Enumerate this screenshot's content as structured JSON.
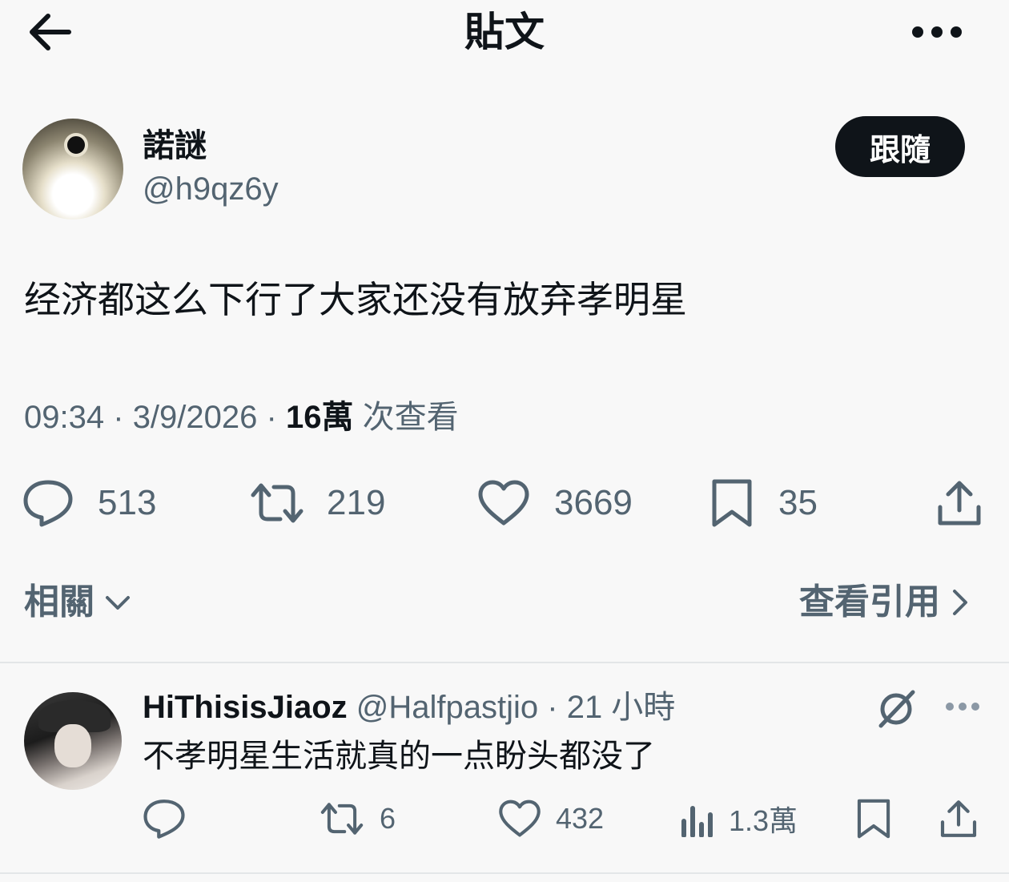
{
  "header": {
    "title": "貼文",
    "back_icon": "arrow-left-icon",
    "more_icon": "more-horizontal-icon"
  },
  "post": {
    "author_name": "諾謎",
    "author_handle": "@h9qz6y",
    "follow_label": "跟隨",
    "text": "经济都这么下行了大家还没有放弃孝明星",
    "time": "09:34",
    "date": "3/9/2026",
    "views_count": "16萬",
    "views_label": "次查看",
    "separator": "·",
    "replies": "513",
    "retweets": "219",
    "likes": "3669",
    "bookmarks": "35"
  },
  "related": {
    "label": "相關",
    "quotes_label": "查看引用"
  },
  "reply": {
    "name": "HiThisisJiaoz",
    "handle": "@Halfpastjio",
    "time": "21 小時",
    "separator": "·",
    "text": "不孝明星生活就真的一点盼头都没了",
    "retweets": "6",
    "likes": "432",
    "views": "1.3萬"
  },
  "colors": {
    "text": "#0f1419",
    "secondary": "#536471",
    "background": "#f8f8f8",
    "button": "#0f1419"
  }
}
